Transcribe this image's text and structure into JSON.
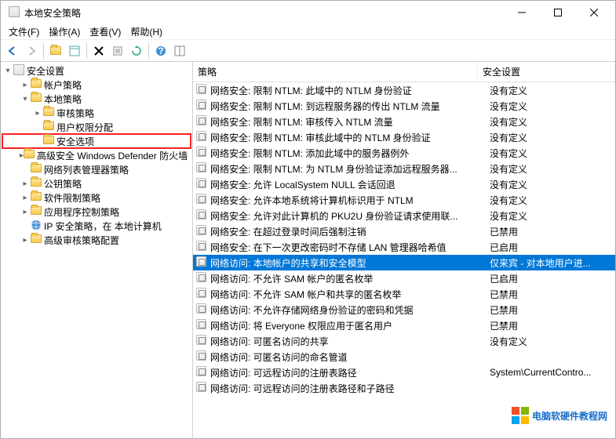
{
  "window": {
    "title": "本地安全策略"
  },
  "menu": {
    "file": "文件(F)",
    "action": "操作(A)",
    "view": "查看(V)",
    "help": "帮助(H)"
  },
  "tree": {
    "root": "安全设置",
    "nodes": [
      {
        "label": "帐户策略",
        "indent": 1,
        "expand": "▸",
        "hl": false
      },
      {
        "label": "本地策略",
        "indent": 1,
        "expand": "▾",
        "hl": false
      },
      {
        "label": "审核策略",
        "indent": 2,
        "expand": "▸",
        "hl": false
      },
      {
        "label": "用户权限分配",
        "indent": 2,
        "expand": "",
        "hl": false
      },
      {
        "label": "安全选项",
        "indent": 2,
        "expand": "",
        "hl": true
      },
      {
        "label": "高级安全 Windows Defender 防火墙",
        "indent": 1,
        "expand": "▸",
        "hl": false
      },
      {
        "label": "网络列表管理器策略",
        "indent": 1,
        "expand": "",
        "hl": false
      },
      {
        "label": "公钥策略",
        "indent": 1,
        "expand": "▸",
        "hl": false
      },
      {
        "label": "软件限制策略",
        "indent": 1,
        "expand": "▸",
        "hl": false
      },
      {
        "label": "应用程序控制策略",
        "indent": 1,
        "expand": "▸",
        "hl": false
      },
      {
        "label": "IP 安全策略，在 本地计算机",
        "indent": 1,
        "expand": "",
        "hl": false,
        "icon": "ip"
      },
      {
        "label": "高级审核策略配置",
        "indent": 1,
        "expand": "▸",
        "hl": false
      }
    ]
  },
  "list": {
    "col_policy": "策略",
    "col_setting": "安全设置",
    "rows": [
      {
        "policy": "网络安全: 限制 NTLM: 此域中的 NTLM 身份验证",
        "setting": "没有定义",
        "sel": false
      },
      {
        "policy": "网络安全: 限制 NTLM: 到远程服务器的传出 NTLM 流量",
        "setting": "没有定义",
        "sel": false
      },
      {
        "policy": "网络安全: 限制 NTLM: 审核传入 NTLM 流量",
        "setting": "没有定义",
        "sel": false
      },
      {
        "policy": "网络安全: 限制 NTLM: 审核此域中的 NTLM 身份验证",
        "setting": "没有定义",
        "sel": false
      },
      {
        "policy": "网络安全: 限制 NTLM: 添加此域中的服务器例外",
        "setting": "没有定义",
        "sel": false
      },
      {
        "policy": "网络安全: 限制 NTLM: 为 NTLM 身份验证添加远程服务器...",
        "setting": "没有定义",
        "sel": false
      },
      {
        "policy": "网络安全: 允许 LocalSystem NULL 会话回退",
        "setting": "没有定义",
        "sel": false
      },
      {
        "policy": "网络安全: 允许本地系统将计算机标识用于 NTLM",
        "setting": "没有定义",
        "sel": false
      },
      {
        "policy": "网络安全: 允许对此计算机的 PKU2U 身份验证请求使用联...",
        "setting": "没有定义",
        "sel": false
      },
      {
        "policy": "网络安全: 在超过登录时间后强制注销",
        "setting": "已禁用",
        "sel": false
      },
      {
        "policy": "网络安全: 在下一次更改密码时不存储 LAN 管理器哈希值",
        "setting": "已启用",
        "sel": false
      },
      {
        "policy": "网络访问: 本地帐户的共享和安全模型",
        "setting": "仅来宾 - 对本地用户进...",
        "sel": true
      },
      {
        "policy": "网络访问: 不允许 SAM 帐户的匿名枚举",
        "setting": "已启用",
        "sel": false
      },
      {
        "policy": "网络访问: 不允许 SAM 帐户和共享的匿名枚举",
        "setting": "已禁用",
        "sel": false
      },
      {
        "policy": "网络访问: 不允许存储网络身份验证的密码和凭据",
        "setting": "已禁用",
        "sel": false
      },
      {
        "policy": "网络访问: 将 Everyone 权限应用于匿名用户",
        "setting": "已禁用",
        "sel": false
      },
      {
        "policy": "网络访问: 可匿名访问的共享",
        "setting": "没有定义",
        "sel": false
      },
      {
        "policy": "网络访问: 可匿名访问的命名管道",
        "setting": "",
        "sel": false
      },
      {
        "policy": "网络访问: 可远程访问的注册表路径",
        "setting": "System\\CurrentContro...",
        "sel": false
      },
      {
        "policy": "网络访问: 可远程访问的注册表路径和子路径",
        "setting": "",
        "sel": false
      }
    ]
  },
  "watermark": "电脑软硬件教程网"
}
